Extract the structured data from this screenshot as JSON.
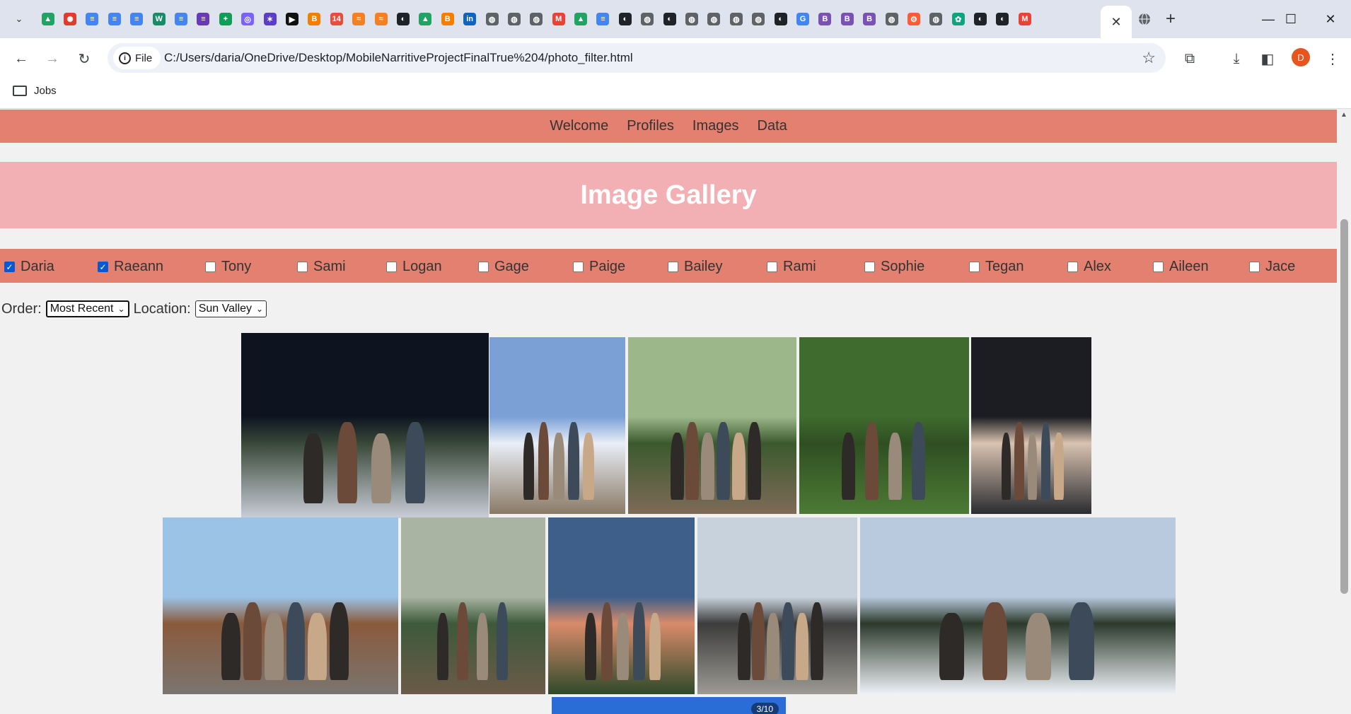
{
  "browser": {
    "url": "C:/Users/daria/OneDrive/Desktop/MobileNarritiveProjectFinalTrue%204/photo_filter.html",
    "url_chip": "File",
    "bookmark": "Jobs",
    "profile_initial": "D",
    "tab_icons": [
      {
        "name": "google-drive-icon",
        "color": "#1fa463",
        "glyph": "▲"
      },
      {
        "name": "canvas-icon",
        "color": "#e13b2b",
        "glyph": "✺"
      },
      {
        "name": "google-docs-icon",
        "color": "#4285f4",
        "glyph": "≡"
      },
      {
        "name": "google-docs-icon",
        "color": "#4285f4",
        "glyph": "≡"
      },
      {
        "name": "google-docs-icon",
        "color": "#4285f4",
        "glyph": "≡"
      },
      {
        "name": "wordpress-icon",
        "color": "#178c66",
        "glyph": "W"
      },
      {
        "name": "google-docs-icon",
        "color": "#4285f4",
        "glyph": "≡"
      },
      {
        "name": "google-forms-icon",
        "color": "#673ab7",
        "glyph": "≡"
      },
      {
        "name": "google-sheets-icon",
        "color": "#0f9d58",
        "glyph": "+"
      },
      {
        "name": "globe-icon",
        "color": "#7b61ff",
        "glyph": "◎"
      },
      {
        "name": "gemini-icon",
        "color": "#5b3ec8",
        "glyph": "✶"
      },
      {
        "name": "pluralsight-icon",
        "color": "#111111",
        "glyph": "▶"
      },
      {
        "name": "blogger-icon",
        "color": "#f57d00",
        "glyph": "B"
      },
      {
        "name": "notification-icon",
        "color": "#e74c3c",
        "glyph": "14"
      },
      {
        "name": "stack-overflow-icon",
        "color": "#f48024",
        "glyph": "≈"
      },
      {
        "name": "stack-overflow-icon",
        "color": "#f48024",
        "glyph": "≈"
      },
      {
        "name": "github-icon",
        "color": "#1f2328",
        "glyph": "◐"
      },
      {
        "name": "google-drive-icon",
        "color": "#1fa463",
        "glyph": "▲"
      },
      {
        "name": "blogger-icon",
        "color": "#f57d00",
        "glyph": "B"
      },
      {
        "name": "linkedin-icon",
        "color": "#0a66c2",
        "glyph": "in"
      },
      {
        "name": "globe-icon",
        "color": "#5f6368",
        "glyph": "◍"
      },
      {
        "name": "globe-icon",
        "color": "#5f6368",
        "glyph": "◍"
      },
      {
        "name": "globe-icon",
        "color": "#5f6368",
        "glyph": "◍"
      },
      {
        "name": "gmail-icon",
        "color": "#ea4335",
        "glyph": "M"
      },
      {
        "name": "google-drive-icon",
        "color": "#1fa463",
        "glyph": "▲"
      },
      {
        "name": "google-docs-icon",
        "color": "#4285f4",
        "glyph": "≡"
      },
      {
        "name": "github-icon",
        "color": "#1f2328",
        "glyph": "◐"
      },
      {
        "name": "globe-icon",
        "color": "#5f6368",
        "glyph": "◍"
      },
      {
        "name": "github-icon",
        "color": "#1f2328",
        "glyph": "◐"
      },
      {
        "name": "globe-icon",
        "color": "#5f6368",
        "glyph": "◍"
      },
      {
        "name": "globe-icon",
        "color": "#5f6368",
        "glyph": "◍"
      },
      {
        "name": "globe-icon",
        "color": "#5f6368",
        "glyph": "◍"
      },
      {
        "name": "globe-icon",
        "color": "#5f6368",
        "glyph": "◍"
      },
      {
        "name": "github-icon",
        "color": "#1f2328",
        "glyph": "◐"
      },
      {
        "name": "google-icon",
        "color": "#4285f4",
        "glyph": "G"
      },
      {
        "name": "bootstrap-icon",
        "color": "#7952b3",
        "glyph": "B"
      },
      {
        "name": "bootstrap-icon",
        "color": "#7952b3",
        "glyph": "B"
      },
      {
        "name": "bootstrap-icon",
        "color": "#7952b3",
        "glyph": "B"
      },
      {
        "name": "globe-icon",
        "color": "#5f6368",
        "glyph": "◍"
      },
      {
        "name": "hubspot-icon",
        "color": "#ff5c35",
        "glyph": "⚙"
      },
      {
        "name": "globe-icon",
        "color": "#5f6368",
        "glyph": "◍"
      },
      {
        "name": "chatgpt-icon",
        "color": "#10a37f",
        "glyph": "✿"
      },
      {
        "name": "github-icon",
        "color": "#1f2328",
        "glyph": "◐"
      },
      {
        "name": "github-icon",
        "color": "#1f2328",
        "glyph": "◐"
      },
      {
        "name": "gmail-icon",
        "color": "#ea4335",
        "glyph": "M"
      }
    ]
  },
  "nav": {
    "items": [
      "Welcome",
      "Profiles",
      "Images",
      "Data"
    ]
  },
  "page_title": "Image Gallery",
  "filters": {
    "people": [
      {
        "name": "Daria",
        "checked": true
      },
      {
        "name": "Raeann",
        "checked": true
      },
      {
        "name": "Tony",
        "checked": false
      },
      {
        "name": "Sami",
        "checked": false
      },
      {
        "name": "Logan",
        "checked": false
      },
      {
        "name": "Gage",
        "checked": false
      },
      {
        "name": "Paige",
        "checked": false
      },
      {
        "name": "Bailey",
        "checked": false
      },
      {
        "name": "Rami",
        "checked": false
      },
      {
        "name": "Sophie",
        "checked": false
      },
      {
        "name": "Tegan",
        "checked": false
      },
      {
        "name": "Alex",
        "checked": false
      },
      {
        "name": "Aileen",
        "checked": false
      },
      {
        "name": "Jace",
        "checked": false
      }
    ]
  },
  "controls": {
    "order_label": "Order:",
    "order_value": "Most Recent",
    "location_label": "Location:",
    "location_value": "Sun Valley"
  },
  "photos": [
    {
      "scene": "night-snow-group",
      "sky": "#0d1420",
      "ground": "#c9cdd8",
      "accent": "#3a4a3a"
    },
    {
      "scene": "mountain-summit-group",
      "sky": "#7aa0d6",
      "ground": "#8a7a66",
      "accent": "#e9eef7"
    },
    {
      "scene": "forest-trail-group",
      "sky": "#9cb78a",
      "ground": "#7e6a58",
      "accent": "#3b5a2e"
    },
    {
      "scene": "green-hillside-group",
      "sky": "#3f6b2e",
      "ground": "#4d7a35",
      "accent": "#2f4f22"
    },
    {
      "scene": "night-lake-group",
      "sky": "#1b1d22",
      "ground": "#2a2c30",
      "accent": "#d9c2b0"
    },
    {
      "scene": "town-street-group",
      "sky": "#9bc3e6",
      "ground": "#7a7570",
      "accent": "#8a5a3c"
    },
    {
      "scene": "smalltown-sign-group",
      "sky": "#a9b4a3",
      "ground": "#6b5a48",
      "accent": "#3d5a3a"
    },
    {
      "scene": "sunset-meadow-group",
      "sky": "#3e5f8a",
      "ground": "#2f4a2a",
      "accent": "#d98b6a"
    },
    {
      "scene": "marina-dock-group",
      "sky": "#c8d2dc",
      "ground": "#9d9a94",
      "accent": "#3c3c3c"
    },
    {
      "scene": "snowy-mountain-group",
      "sky": "#b9c9de",
      "ground": "#eef2f7",
      "accent": "#2c3a2c"
    },
    {
      "scene": "blue-sky-partial",
      "sky": "#2a6dd6",
      "ground": "#2a6dd6",
      "accent": "#2a6dd6",
      "counter": "3/10"
    }
  ]
}
